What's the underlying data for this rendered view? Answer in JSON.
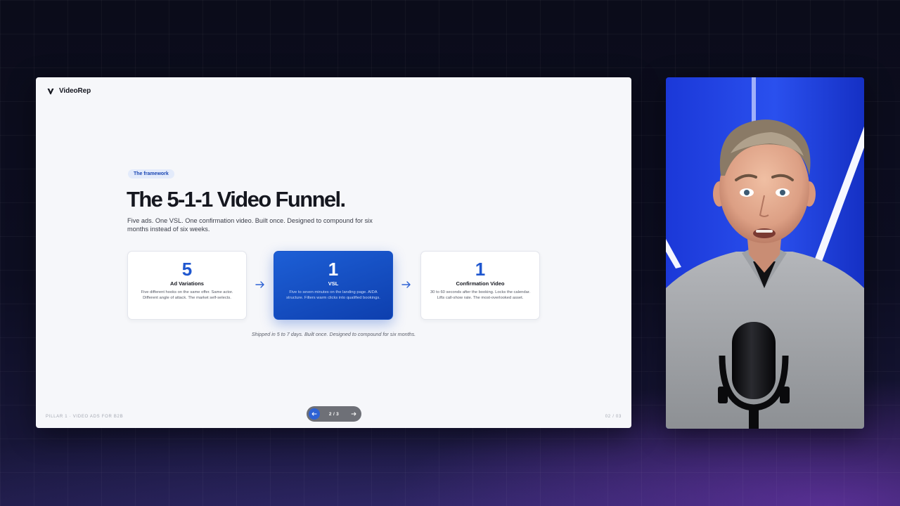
{
  "brand": {
    "name": "VideoRep"
  },
  "slide": {
    "tag": "The framework",
    "title": "The 5-1-1 Video Funnel.",
    "subtitle": "Five ads. One VSL. One confirmation video. Built once. Designed to compound for six months instead of six weeks.",
    "cards": [
      {
        "number": "5",
        "name": "Ad Variations",
        "description": "Five different hooks on the same offer. Same actor. Different angle of attack. The market self-selects."
      },
      {
        "number": "1",
        "name": "VSL",
        "description": "Five to seven minutes on the landing page. AIDA structure. Filters warm clicks into qualified bookings."
      },
      {
        "number": "1",
        "name": "Confirmation Video",
        "description": "30 to 60 seconds after the booking. Locks the calendar. Lifts call-show rate. The most-overlooked asset."
      }
    ],
    "footnote": "Shipped in 5 to 7 days. Built once. Designed to compound for six months.",
    "footer_left": "PILLAR 1 · VIDEO ADS FOR B2B",
    "footer_right": "02 / 03"
  },
  "pager": {
    "count": "2 / 3",
    "prev_icon": "arrow-left-icon",
    "next_icon": "arrow-right-icon"
  },
  "colors": {
    "accent": "#1f57cf",
    "highlight_card": "#1d5fd6",
    "slide_bg": "#f6f7fa",
    "page_bg": "#0d0e22"
  },
  "webcam": {
    "icon": "presenter-webcam-feed"
  }
}
